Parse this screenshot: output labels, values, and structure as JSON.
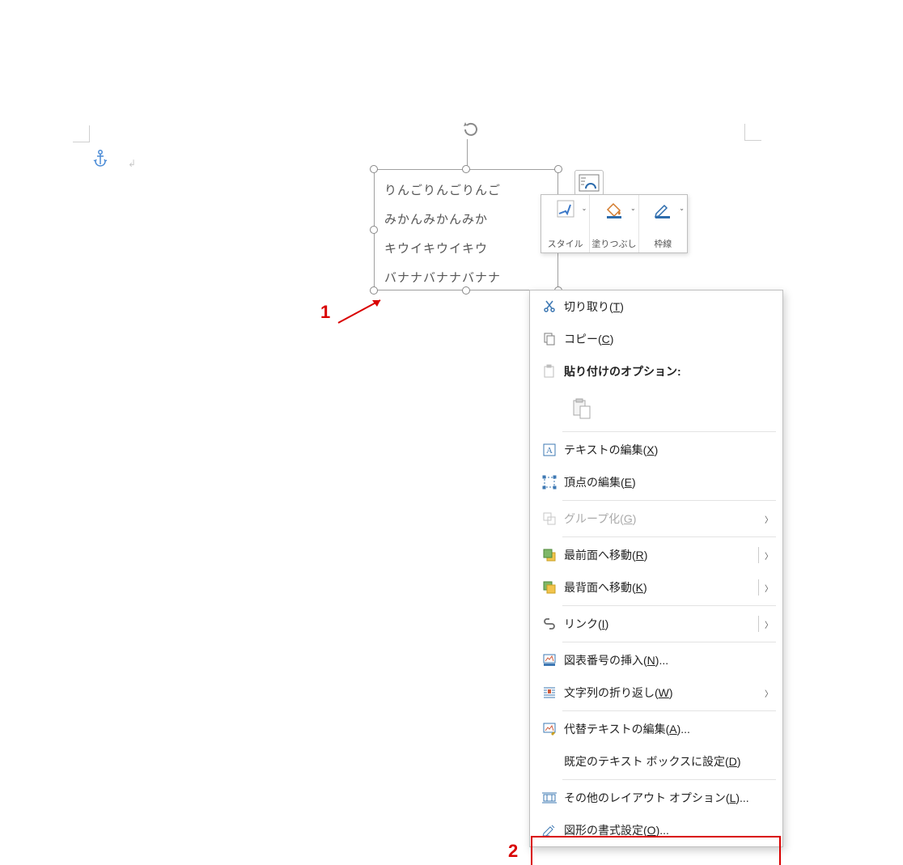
{
  "shape": {
    "lines": [
      "りんごりんごりんご",
      "みかんみかんみか",
      "キウイキウイキウ",
      "バナナバナナバナナ"
    ]
  },
  "miniToolbar": {
    "style": "スタイル",
    "fill": "塗りつぶし",
    "outline": "枠線"
  },
  "contextMenu": {
    "cut": "切り取り(",
    "cut_key": "T",
    "cut_tail": ")",
    "copy": "コピー(",
    "copy_key": "C",
    "copy_tail": ")",
    "pasteHeader": "貼り付けのオプション:",
    "editText": "テキストの編集(",
    "editText_key": "X",
    "editText_tail": ")",
    "editPoints": "頂点の編集(",
    "editPoints_key": "E",
    "editPoints_tail": ")",
    "group": "グループ化(",
    "group_key": "G",
    "group_tail": ")",
    "bringFront": "最前面へ移動(",
    "bringFront_key": "R",
    "bringFront_tail": ")",
    "sendBack": "最背面へ移動(",
    "sendBack_key": "K",
    "sendBack_tail": ")",
    "link": "リンク(",
    "link_key": "I",
    "link_tail": ")",
    "caption": "図表番号の挿入(",
    "caption_key": "N",
    "caption_tail": ")...",
    "wrap": "文字列の折り返し(",
    "wrap_key": "W",
    "wrap_tail": ")",
    "altText": "代替テキストの編集(",
    "altText_key": "A",
    "altText_tail": ")...",
    "defaultTB": "既定のテキスト ボックスに設定(",
    "defaultTB_key": "D",
    "defaultTB_tail": ")",
    "moreLayout": "その他のレイアウト オプション(",
    "moreLayout_key": "L",
    "moreLayout_tail": ")...",
    "formatShape": "図形の書式設定(",
    "formatShape_key": "O",
    "formatShape_tail": ")..."
  },
  "annotations": {
    "n1": "1",
    "n2": "2"
  }
}
